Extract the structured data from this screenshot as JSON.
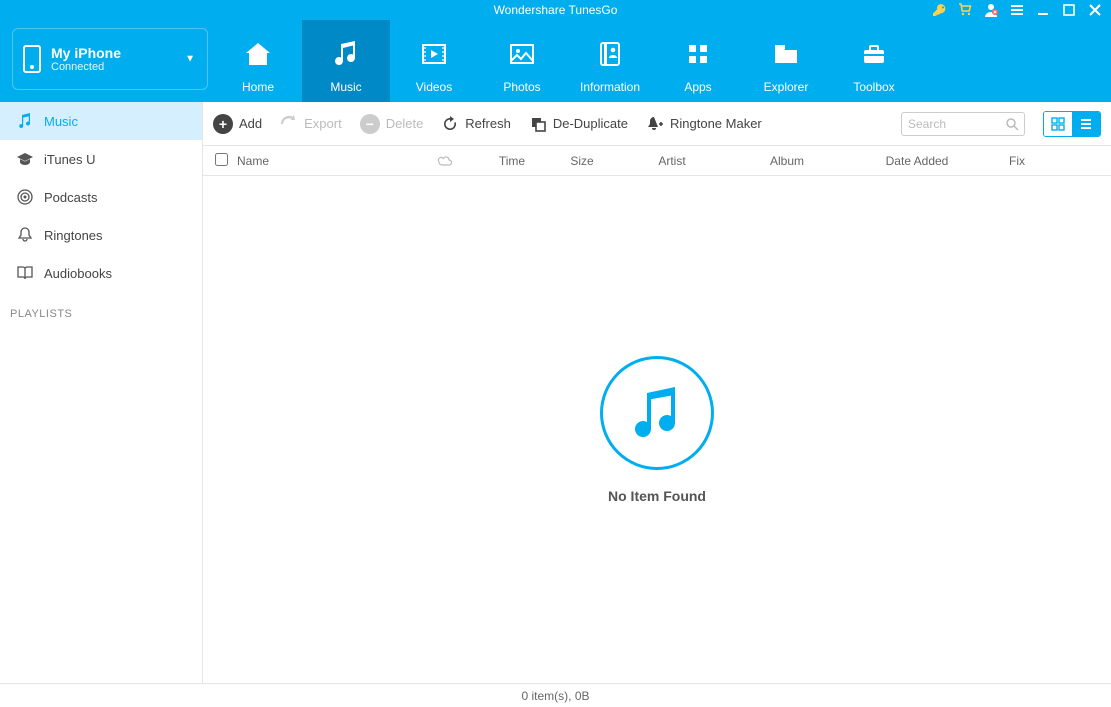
{
  "app": {
    "title": "Wondershare TunesGo"
  },
  "device": {
    "name": "My iPhone",
    "status": "Connected"
  },
  "nav": {
    "home": "Home",
    "music": "Music",
    "videos": "Videos",
    "photos": "Photos",
    "information": "Information",
    "apps": "Apps",
    "explorer": "Explorer",
    "toolbox": "Toolbox"
  },
  "sidebar": {
    "music": "Music",
    "itunesu": "iTunes U",
    "podcasts": "Podcasts",
    "ringtones": "Ringtones",
    "audiobooks": "Audiobooks",
    "playlists_header": "PLAYLISTS"
  },
  "toolbar": {
    "add": "Add",
    "export": "Export",
    "delete": "Delete",
    "refresh": "Refresh",
    "deduplicate": "De-Duplicate",
    "ringtone_maker": "Ringtone Maker",
    "search_placeholder": "Search"
  },
  "columns": {
    "name": "Name",
    "time": "Time",
    "size": "Size",
    "artist": "Artist",
    "album": "Album",
    "date_added": "Date Added",
    "fix": "Fix"
  },
  "empty": {
    "message": "No Item Found"
  },
  "status": {
    "text": "0 item(s), 0B"
  }
}
